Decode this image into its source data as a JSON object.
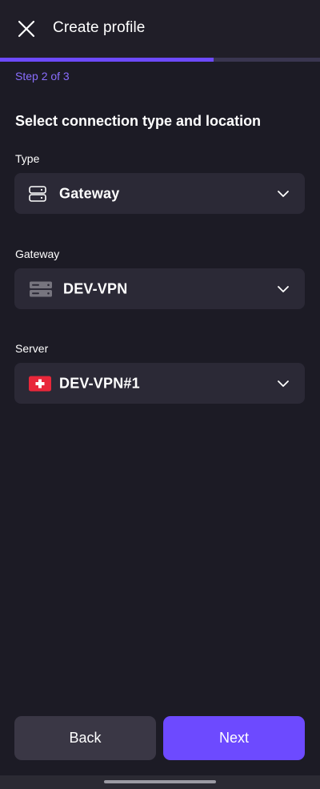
{
  "header": {
    "title": "Create profile",
    "close_icon": "close-icon"
  },
  "progress": {
    "step_label": "Step 2 of 3",
    "fraction": 0.667,
    "accent": "#6d4aff"
  },
  "main": {
    "section_title": "Select connection type and location",
    "fields": {
      "type": {
        "label": "Type",
        "value": "Gateway",
        "icon": "server-outline-icon"
      },
      "gateway": {
        "label": "Gateway",
        "value": "DEV-VPN",
        "icon": "server-filled-icon"
      },
      "server": {
        "label": "Server",
        "value": "DEV-VPN#1",
        "icon": "switzerland-flag-icon"
      }
    }
  },
  "footer": {
    "back_label": "Back",
    "next_label": "Next"
  },
  "colors": {
    "background": "#1c1b25",
    "field_bg": "#2b2936",
    "accent": "#6d4aff",
    "step_text": "#8a6eff"
  }
}
